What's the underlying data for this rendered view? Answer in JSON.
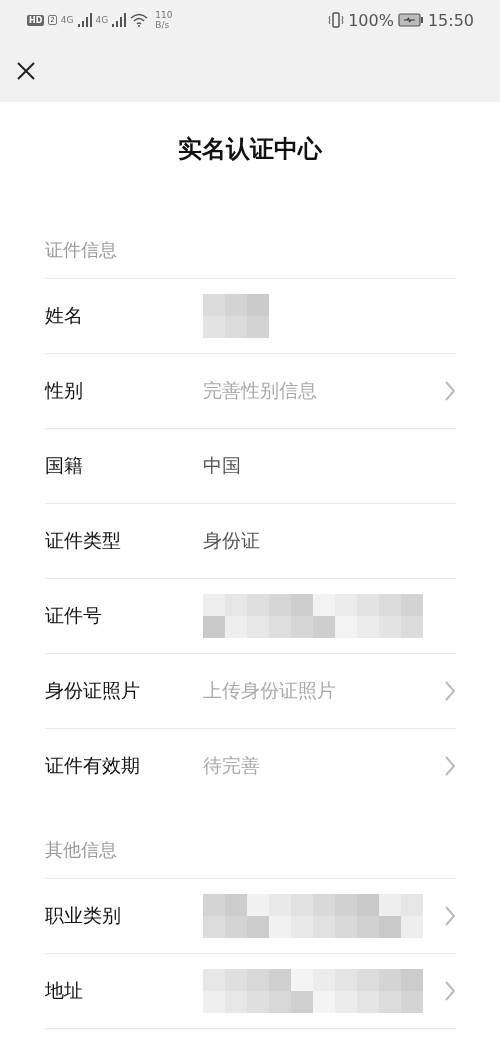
{
  "status_bar": {
    "hd_label": "HD",
    "sim_slot": "2",
    "networks": [
      {
        "type": "4G"
      },
      {
        "type": "4G"
      }
    ],
    "speed": "110",
    "speed_unit": "B/s",
    "battery": "100%",
    "time": "15:50"
  },
  "title": "实名认证中心",
  "sections": [
    {
      "heading": "证件信息",
      "rows": [
        {
          "label": "姓名",
          "kind": "redacted",
          "arrow": false
        },
        {
          "label": "性别",
          "kind": "placeholder",
          "placeholder": "完善性别信息",
          "arrow": true
        },
        {
          "label": "国籍",
          "kind": "text",
          "value": "中国",
          "arrow": false
        },
        {
          "label": "证件类型",
          "kind": "text",
          "value": "身份证",
          "arrow": false
        },
        {
          "label": "证件号",
          "kind": "redacted",
          "arrow": false
        },
        {
          "label": "身份证照片",
          "kind": "placeholder",
          "placeholder": "上传身份证照片",
          "arrow": true
        },
        {
          "label": "证件有效期",
          "kind": "placeholder",
          "placeholder": "待完善",
          "arrow": true
        }
      ]
    },
    {
      "heading": "其他信息",
      "rows": [
        {
          "label": "职业类别",
          "kind": "redacted",
          "arrow": true
        },
        {
          "label": "地址",
          "kind": "redacted",
          "arrow": true
        }
      ]
    }
  ]
}
